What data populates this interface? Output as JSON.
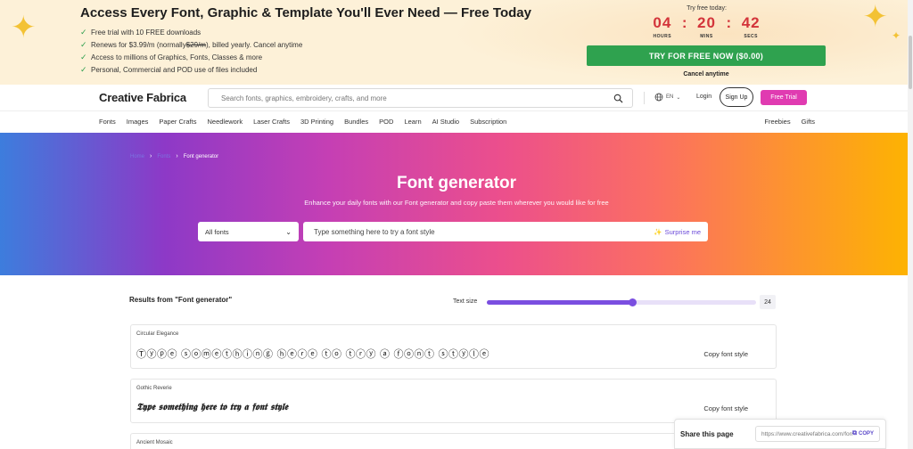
{
  "promo": {
    "title": "Access Every Font, Graphic & Template You'll Ever Need — Free Today",
    "bullets": [
      "Free trial with 10 FREE downloads",
      "Renews for $3.99/m (normally ",
      "Access to millions of Graphics, Fonts, Classes & more",
      "Personal, Commercial and POD use of files included"
    ],
    "renew_strike": "$29/m",
    "renew_rest": "), billed yearly. Cancel anytime",
    "try_label": "Try free today:",
    "timer": {
      "hours": "04",
      "mins": "20",
      "secs": "42",
      "hours_label": "HOURS",
      "mins_label": "MINS",
      "secs_label": "SECS"
    },
    "cta_label": "TRY FOR FREE NOW ($0.00)",
    "cancel_label": "Cancel anytime",
    "colors": {
      "background": "#fdf1d8",
      "cta": "#2fa24f",
      "timer": "#d3343a",
      "sparkle": "#f3c234"
    }
  },
  "header": {
    "logo": "Creative Fabrica",
    "search_placeholder": "Search fonts, graphics, embroidery, crafts, and more",
    "lang": "EN",
    "login": "Login",
    "signup": "Sign Up",
    "free_trial": "Free Trial",
    "colors": {
      "free_trial": "#e03bb1"
    }
  },
  "nav": {
    "left": [
      "Fonts",
      "Images",
      "Paper Crafts",
      "Needlework",
      "Laser Crafts",
      "3D Printing",
      "Bundles",
      "POD",
      "Learn",
      "AI Studio",
      "Subscription"
    ],
    "right": [
      "Freebies",
      "Gifts"
    ]
  },
  "hero": {
    "breadcrumbs": [
      "Home",
      "Fonts",
      "Font generator"
    ],
    "title": "Font generator",
    "subtitle": "Enhance your daily fonts with our Font generator and copy paste them wherever you would like for free",
    "select_value": "All fonts",
    "input_placeholder": "Type something here to try a font style",
    "surprise": "Surprise me"
  },
  "results": {
    "title": "Results from \"Font generator\"",
    "text_size_label": "Text size",
    "text_size_value": "24",
    "slider_fraction": 0.54,
    "cards": [
      {
        "name": "Circular Elegance",
        "sample": "Ⓣⓨⓟⓔ ⓢⓞⓜⓔⓣⓗⓘⓝⓖ ⓗⓔⓡⓔ ⓣⓞ ⓣⓡⓨ ⓐ ⓕⓞⓝⓣ ⓢⓣⓨⓛⓔ",
        "copy": "Copy font style"
      },
      {
        "name": "Gothic Reverie",
        "sample": "𝕿𝖞𝖕𝖊 𝖘𝖔𝖒𝖊𝖙𝖍𝖎𝖓𝖌 𝖍𝖊𝖗𝖊 𝖙𝖔 𝖙𝖗𝖞 𝖆 𝖋𝖔𝖓𝖙 𝖘𝖙𝖞𝖑𝖊",
        "copy": "Copy font style"
      },
      {
        "name": "Ancient Mosaic"
      }
    ]
  },
  "share": {
    "label": "Share this page",
    "url": "https://www.creativefabrica.com/font-generator/",
    "copy": "COPY"
  }
}
